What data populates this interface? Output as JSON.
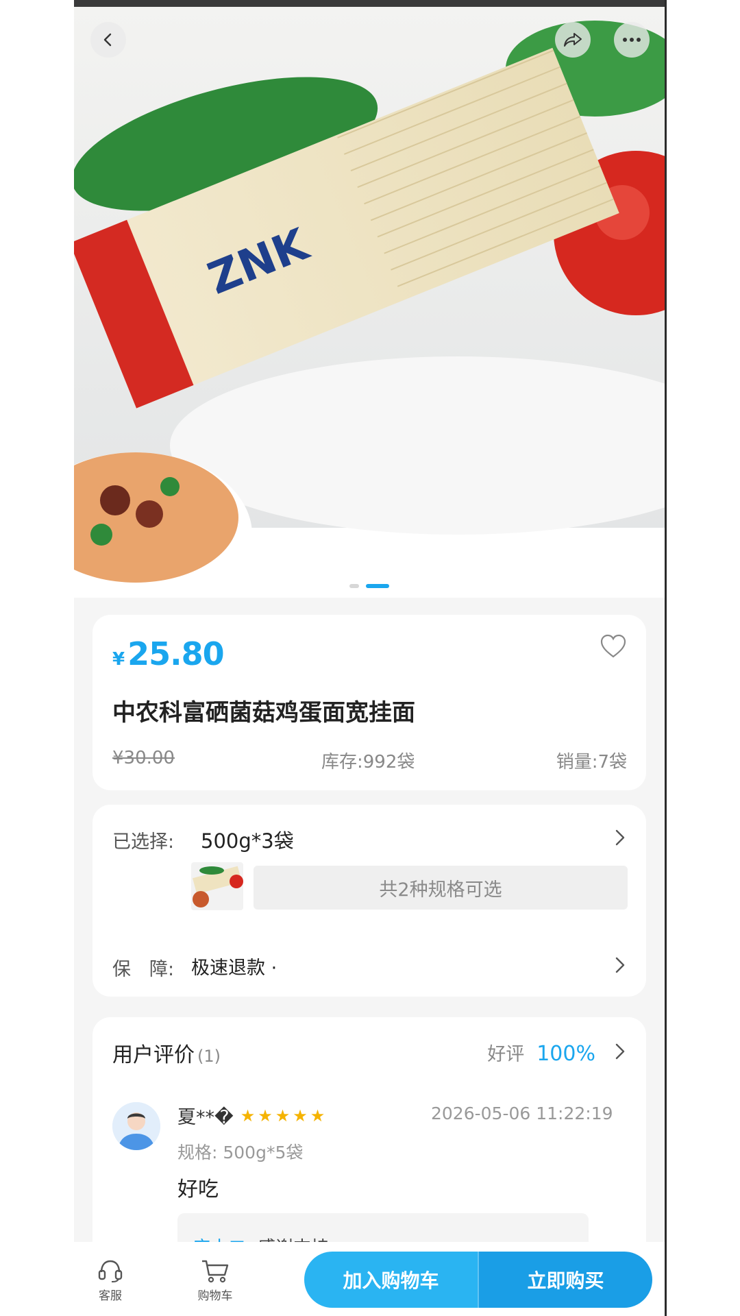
{
  "carousel": {
    "total": 2,
    "active_index": 1
  },
  "product": {
    "price_symbol": "¥",
    "price": "25.80",
    "title": "中农科富硒菌菇鸡蛋面宽挂面",
    "original_price": "¥30.00",
    "stock": "库存:992袋",
    "sales": "销量:7袋"
  },
  "spec": {
    "selected_label": "已选择:",
    "selected_value": "500g*3袋",
    "options_text": "共2种规格可选",
    "guarantee_label": "保　障:",
    "guarantee_value": "极速退款 ·"
  },
  "reviews": {
    "title": "用户评价",
    "count": "(1)",
    "good_label": "好评",
    "good_rate": "100%",
    "items": [
      {
        "name": "夏**�",
        "stars": "★★★★★",
        "rating": 5,
        "date": "2026-05-06 11:22:19",
        "spec": "规格: 500g*5袋",
        "text": "好吃",
        "reply_author": "店小二:",
        "reply_text": "感谢支持"
      }
    ]
  },
  "bottom_bar": {
    "service_label": "客服",
    "cart_label": "购物车",
    "add_to_cart": "加入购物车",
    "buy_now": "立即购买"
  },
  "colors": {
    "accent": "#1aa6ee",
    "star": "#f5b301",
    "background": "#f5f5f5"
  },
  "icons": [
    "back-icon",
    "share-icon",
    "more-icon",
    "heart-icon",
    "chevron-right-icon",
    "headset-icon",
    "cart-icon"
  ]
}
